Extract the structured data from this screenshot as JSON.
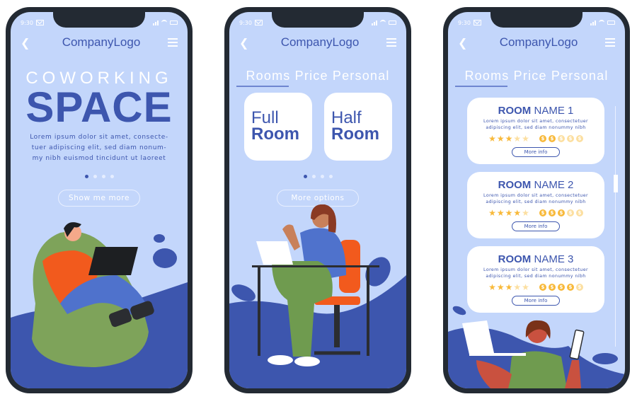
{
  "status_bar": {
    "time": "9:30"
  },
  "screens": [
    {
      "nav": {
        "back_icon": "chevron-left-icon",
        "logo": "CompanyLogo",
        "menu_icon": "hamburger-menu-icon"
      },
      "eyebrow": "COWORKING",
      "headline": "SPACE",
      "description": "Lorem ipsum dolor sit amet, consecte-tuer adipiscing elit, sed diam nonum-my nibh euismod tincidunt ut laoreet",
      "pagination": {
        "total": 4,
        "active": 1
      },
      "button_label": "Show me more",
      "illustration": "man-on-beanbag-with-laptop"
    },
    {
      "nav": {
        "back_icon": "chevron-left-icon",
        "logo": "CompanyLogo",
        "menu_icon": "hamburger-menu-icon"
      },
      "heading": "Rooms Price Personal",
      "options": [
        {
          "line1": "Full",
          "line2": "Room"
        },
        {
          "line1": "Half",
          "line2": "Room"
        }
      ],
      "pagination": {
        "total": 4,
        "active": 1
      },
      "button_label": "More options",
      "illustration": "woman-at-desk-with-laptop"
    },
    {
      "nav": {
        "back_icon": "chevron-left-icon",
        "logo": "CompanyLogo",
        "menu_icon": "hamburger-menu-icon"
      },
      "heading": "Rooms Price Personal",
      "rooms": [
        {
          "title_bold": "ROOM",
          "title_rest": "NAME 1",
          "desc_line1": "Lorem ipsum dolor sit amet, consectetuer",
          "desc_line2": "adipiscing elit, sed diam nonummy nibh",
          "stars": 3,
          "stars_max": 5,
          "price_level": 2,
          "price_max": 5,
          "button": "More info"
        },
        {
          "title_bold": "ROOM",
          "title_rest": "NAME 2",
          "desc_line1": "Lorem ipsum dolor sit amet, consectetuer",
          "desc_line2": "adipiscing elit, sed diam nonummy nibh",
          "stars": 4,
          "stars_max": 5,
          "price_level": 3,
          "price_max": 5,
          "button": "More info"
        },
        {
          "title_bold": "ROOM",
          "title_rest": "NAME 3",
          "desc_line1": "Lorem ipsum dolor sit amet, consectetuer",
          "desc_line2": "adipiscing elit, sed diam nonummy nibh",
          "stars": 3,
          "stars_max": 5,
          "price_level": 4,
          "price_max": 5,
          "button": "More info"
        }
      ],
      "scroll_position": 0.28,
      "illustration": "woman-holding-laptop-and-phone"
    }
  ],
  "colors": {
    "background": "#c3d6fb",
    "primary": "#3d56ae",
    "frame": "#232a33",
    "star": "#f8b93a",
    "star_inactive": "#fcdfa0",
    "accent_green": "#7ea35a",
    "accent_orange": "#f25a1d"
  }
}
